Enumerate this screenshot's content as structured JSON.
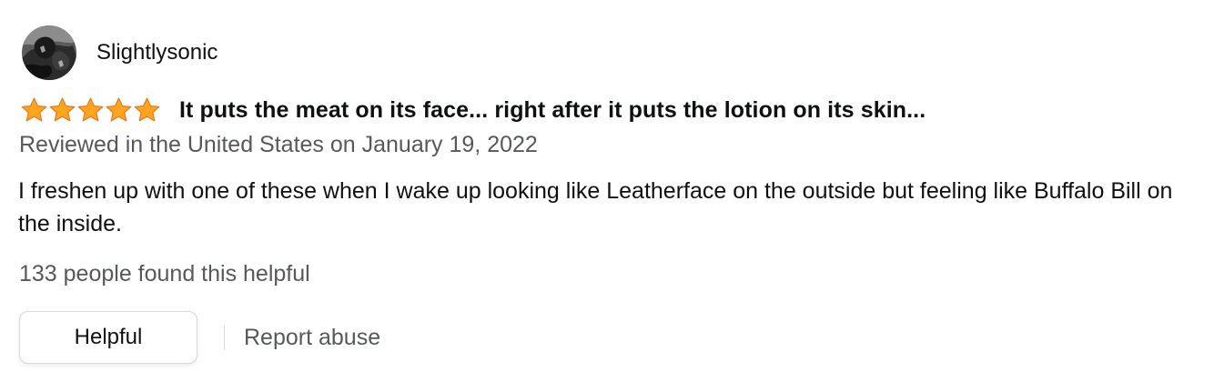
{
  "review": {
    "profile": {
      "name": "Slightlysonic",
      "avatar_icon": "user-avatar-photo"
    },
    "rating": {
      "stars": 5,
      "max_stars": 5,
      "star_color": "#ffa41c",
      "star_icon": "star-icon"
    },
    "title": "It puts the meat on its face... right after it puts the lotion on its skin...",
    "date": "Reviewed in the United States on January 19, 2022",
    "body": "I freshen up with one of these when I wake up looking like Leatherface on the outside but feeling like Buffalo Bill on the inside.",
    "helpful_count": "133 people found this helpful",
    "actions": {
      "helpful_label": "Helpful",
      "report_label": "Report abuse"
    }
  },
  "colors": {
    "text_primary": "#0f1111",
    "text_secondary": "#565959",
    "button_border": "#d5d9d9",
    "star": "#ffa41c"
  }
}
